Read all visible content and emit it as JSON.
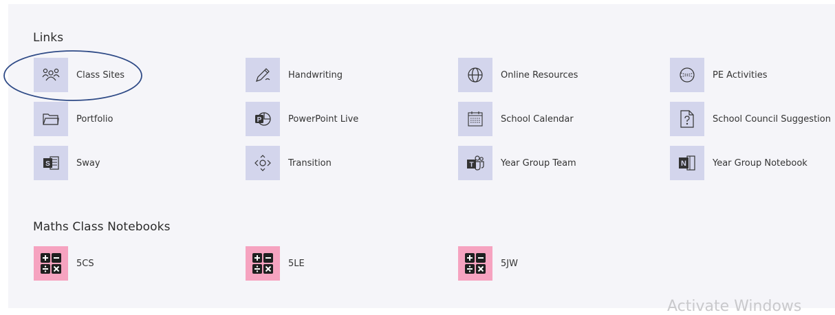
{
  "sections": {
    "links_title": "Links",
    "maths_title": "Maths Class Notebooks"
  },
  "links": [
    {
      "label": "Class Sites",
      "icon": "people-icon"
    },
    {
      "label": "Handwriting",
      "icon": "pen-icon"
    },
    {
      "label": "Online Resources",
      "icon": "globe-icon"
    },
    {
      "label": "PE Activities",
      "icon": "ball-icon"
    },
    {
      "label": "Portfolio",
      "icon": "folder-icon"
    },
    {
      "label": "PowerPoint Live",
      "icon": "powerpoint-icon"
    },
    {
      "label": "School Calendar",
      "icon": "calendar-icon"
    },
    {
      "label": "School Council Suggestion",
      "icon": "question-doc-icon"
    },
    {
      "label": "Sway",
      "icon": "sway-icon"
    },
    {
      "label": "Transition",
      "icon": "transition-icon"
    },
    {
      "label": "Year Group Team",
      "icon": "teams-icon"
    },
    {
      "label": "Year Group Notebook",
      "icon": "onenote-icon"
    }
  ],
  "notebooks": [
    {
      "label": "5CS",
      "icon": "calculator-icon"
    },
    {
      "label": "5LE",
      "icon": "calculator-icon"
    },
    {
      "label": "5JW",
      "icon": "calculator-icon"
    }
  ],
  "watermark": "Activate Windows",
  "colors": {
    "panel_bg": "#f5f5f9",
    "icon_tile_bg": "#d3d5ec",
    "notebook_tile_bg": "#f6a3c0",
    "annotation_circle": "#2e4a86"
  }
}
